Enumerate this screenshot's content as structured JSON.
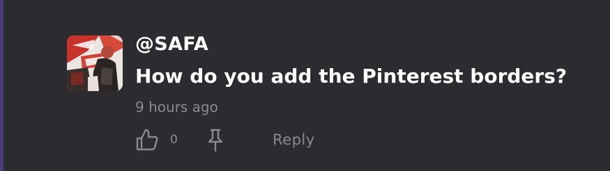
{
  "comment": {
    "username": "@SAFA",
    "text": "How do you add the Pinterest borders?",
    "timestamp": "9 hours ago",
    "likes": "0",
    "reply_label": "Reply"
  },
  "icons": {
    "like": "thumbs-up-icon",
    "pin": "pin-icon"
  },
  "colors": {
    "background": "#2c2c30",
    "accent_bar": "#4a3a78",
    "primary_text": "#ffffff",
    "muted_text": "#8a8a90"
  }
}
